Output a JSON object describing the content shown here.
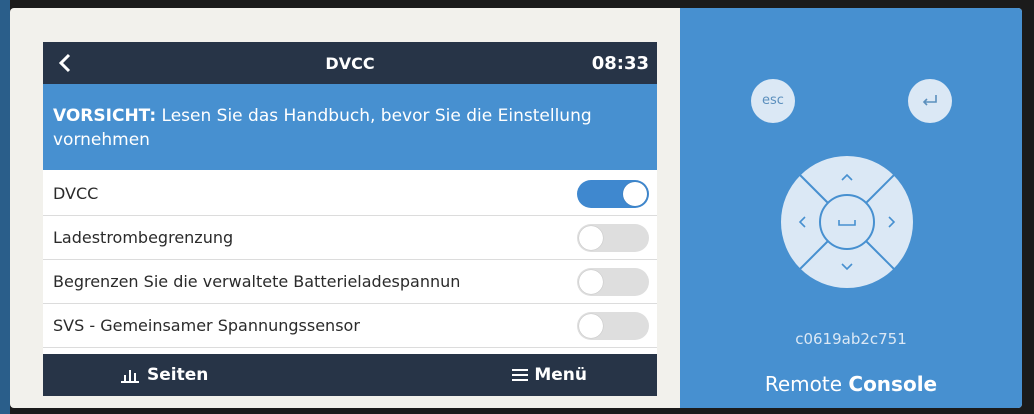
{
  "header": {
    "back_icon": "chevron-left-icon",
    "title": "DVCC",
    "time": "08:33"
  },
  "warning": {
    "label": "VORSICHT:",
    "text": " Lesen Sie das Handbuch, bevor Sie die Einstellung vornehmen"
  },
  "settings": [
    {
      "label": "DVCC",
      "enabled": true
    },
    {
      "label": "Ladestrombegrenzung",
      "enabled": false
    },
    {
      "label": "Begrenzen Sie die verwaltete Batterieladespannun",
      "enabled": false
    },
    {
      "label": "SVS - Gemeinsamer Spannungssensor",
      "enabled": false
    }
  ],
  "footer": {
    "pages_label": "Seiten",
    "pages_icon": "bar-chart-icon",
    "menu_label": "Menü",
    "menu_icon": "hamburger-icon"
  },
  "remote": {
    "esc_label": "esc",
    "enter_icon": "enter-return-icon",
    "device_id": "c0619ab2c751",
    "brand_regular": "Remote",
    "brand_bold": "Console"
  },
  "colors": {
    "bar": "#273447",
    "accent": "#4790d0",
    "toggle_on": "#3f88cf",
    "toggle_off": "#dedede"
  }
}
